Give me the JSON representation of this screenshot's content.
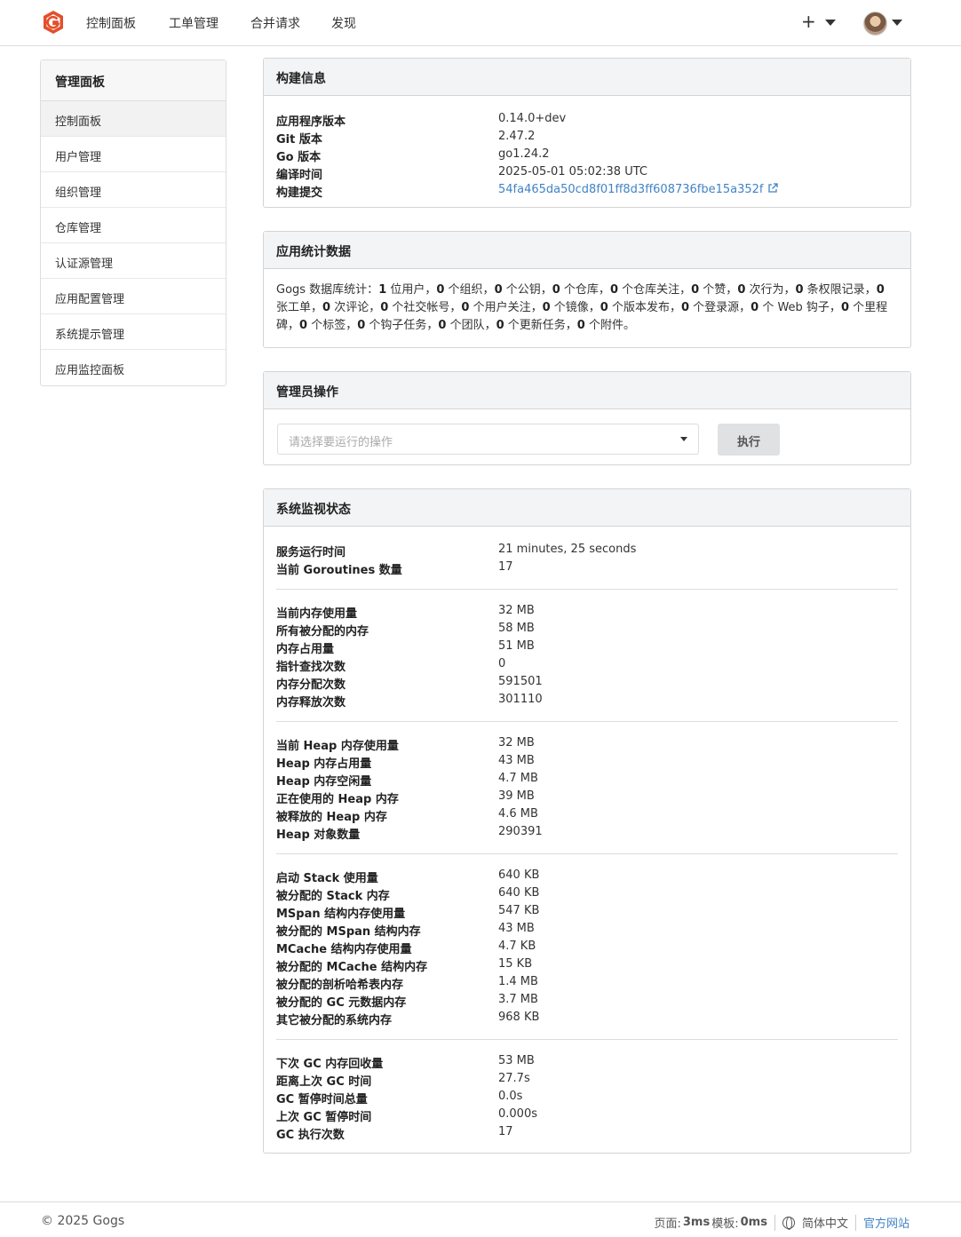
{
  "nav": {
    "items": [
      "控制面板",
      "工单管理",
      "合并请求",
      "发现"
    ],
    "plus": "+",
    "brand_color": "#e44e2b"
  },
  "sidebar": {
    "header": "管理面板",
    "items": [
      "控制面板",
      "用户管理",
      "组织管理",
      "仓库管理",
      "认证源管理",
      "应用配置管理",
      "系统提示管理",
      "应用监控面板"
    ]
  },
  "build": {
    "title": "构建信息",
    "rows": [
      {
        "key": "应用程序版本",
        "value": "0.14.0+dev"
      },
      {
        "key": "Git 版本",
        "value": "2.47.2"
      },
      {
        "key": "Go 版本",
        "value": "go1.24.2"
      },
      {
        "key": "编译时间",
        "value": "2025-05-01 05:02:38 UTC"
      },
      {
        "key": "构建提交",
        "value": "54fa465da50cd8f01ff8d3ff608736fbe15a352f"
      }
    ]
  },
  "stats": {
    "title": "应用统计数据",
    "prefix": "Gogs 数据库统计：",
    "parts": [
      [
        "1",
        " 位用户，"
      ],
      [
        "0",
        " 个组织，"
      ],
      [
        "0",
        " 个公钥，"
      ],
      [
        "0",
        " 个仓库，"
      ],
      [
        "0",
        " 个仓库关注，"
      ],
      [
        "0",
        " 个赞，"
      ],
      [
        "0",
        " 次行为，"
      ],
      [
        "0",
        " 条权限记录，"
      ],
      [
        "0",
        " 张工单，"
      ],
      [
        "0",
        " 次评论，"
      ],
      [
        "0",
        " 个社交帐号，"
      ],
      [
        "0",
        " 个用户关注，"
      ],
      [
        "0",
        " 个镜像，"
      ],
      [
        "0",
        " 个版本发布，"
      ],
      [
        "0",
        " 个登录源，"
      ],
      [
        "0",
        " 个 Web 钩子，"
      ],
      [
        "0",
        " 个里程碑，"
      ],
      [
        "0",
        " 个标签，"
      ],
      [
        "0",
        " 个钩子任务，"
      ],
      [
        "0",
        " 个团队，"
      ],
      [
        "0",
        " 个更新任务，"
      ],
      [
        "0",
        " 个附件。"
      ]
    ]
  },
  "ops": {
    "title": "管理员操作",
    "placeholder": "请选择要运行的操作",
    "execute": "执行"
  },
  "monitor": {
    "title": "系统监视状态",
    "groups": [
      [
        {
          "key": "服务运行时间",
          "value": "21 minutes, 25 seconds"
        },
        {
          "key": "当前 Goroutines 数量",
          "value": "17"
        }
      ],
      [
        {
          "key": "当前内存使用量",
          "value": "32 MB"
        },
        {
          "key": "所有被分配的内存",
          "value": "58 MB"
        },
        {
          "key": "内存占用量",
          "value": "51 MB"
        },
        {
          "key": "指针查找次数",
          "value": "0"
        },
        {
          "key": "内存分配次数",
          "value": "591501"
        },
        {
          "key": "内存释放次数",
          "value": "301110"
        }
      ],
      [
        {
          "key": "当前 Heap 内存使用量",
          "value": "32 MB"
        },
        {
          "key": "Heap 内存占用量",
          "value": "43 MB"
        },
        {
          "key": "Heap 内存空闲量",
          "value": "4.7 MB"
        },
        {
          "key": "正在使用的 Heap 内存",
          "value": "39 MB"
        },
        {
          "key": "被释放的 Heap 内存",
          "value": "4.6 MB"
        },
        {
          "key": "Heap 对象数量",
          "value": "290391"
        }
      ],
      [
        {
          "key": "启动 Stack 使用量",
          "value": "640 KB"
        },
        {
          "key": "被分配的 Stack 内存",
          "value": "640 KB"
        },
        {
          "key": "MSpan 结构内存使用量",
          "value": "547 KB"
        },
        {
          "key": "被分配的 MSpan 结构内存",
          "value": "43 MB"
        },
        {
          "key": "MCache 结构内存使用量",
          "value": "4.7 KB"
        },
        {
          "key": "被分配的 MCache 结构内存",
          "value": "15 KB"
        },
        {
          "key": "被分配的剖析哈希表内存",
          "value": "1.4 MB"
        },
        {
          "key": "被分配的 GC 元数据内存",
          "value": "3.7 MB"
        },
        {
          "key": "其它被分配的系统内存",
          "value": "968 KB"
        }
      ],
      [
        {
          "key": "下次 GC 内存回收量",
          "value": "53 MB"
        },
        {
          "key": "距离上次 GC 时间",
          "value": "27.7s"
        },
        {
          "key": "GC 暂停时间总量",
          "value": "0.0s"
        },
        {
          "key": "上次 GC 暂停时间",
          "value": "0.000s"
        },
        {
          "key": "GC 执行次数",
          "value": "17"
        }
      ]
    ]
  },
  "footer": {
    "copyright": "© 2025 Gogs",
    "page_label": "页面: ",
    "page_time": "3ms",
    "template_label": " 模板: ",
    "template_time": "0ms",
    "language": "简体中文",
    "website": "官方网站"
  }
}
